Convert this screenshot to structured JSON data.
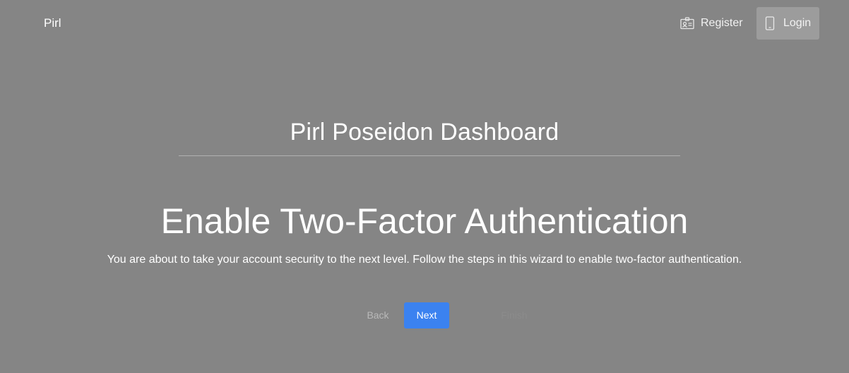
{
  "brand": {
    "name": "Pirl"
  },
  "nav": {
    "register": {
      "label": "Register",
      "icon": "id-card-icon"
    },
    "login": {
      "label": "Login",
      "icon": "mobile-phone-icon"
    }
  },
  "dashboard": {
    "title": "Pirl Poseidon Dashboard"
  },
  "wizard": {
    "heading": "Enable Two-Factor Authentication",
    "description": "You are about to take your account security to the next level. Follow the steps in this wizard to enable two-factor authentication.",
    "back_label": "Back",
    "next_label": "Next",
    "finish_label": "Finish"
  },
  "colors": {
    "background": "#858585",
    "primary_button": "#3b82f0",
    "login_highlight": "#9c9c9c"
  }
}
